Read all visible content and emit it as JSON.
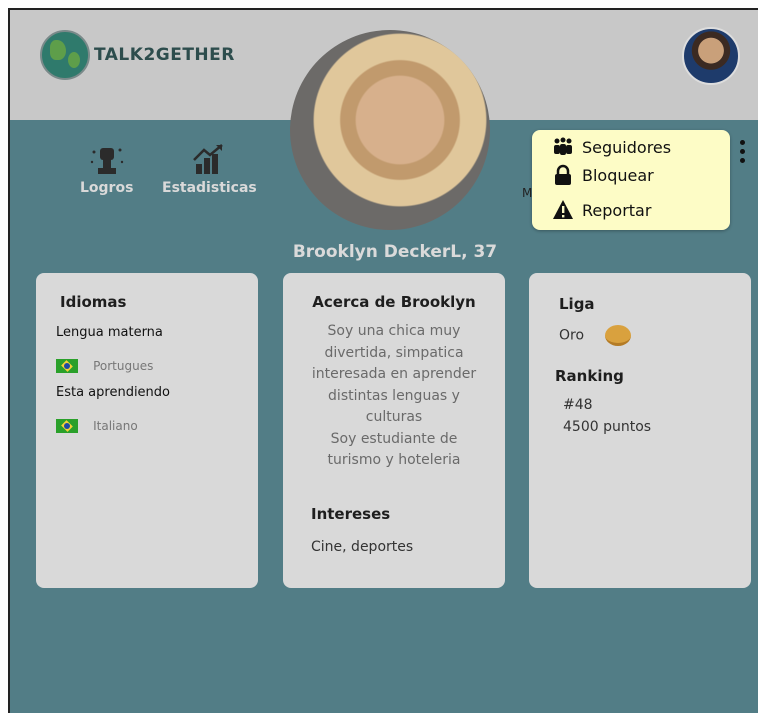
{
  "app": {
    "logo_text": "TALK2GETHER"
  },
  "nav": {
    "logros": "Logros",
    "estadisticas": "Estadisticas"
  },
  "profile": {
    "name": "Brooklyn DeckerL, 37"
  },
  "menu": {
    "items": [
      {
        "label": "Seguidores",
        "icon": "followers-icon"
      },
      {
        "label": "Bloquear",
        "icon": "lock-icon"
      },
      {
        "label": "Reportar",
        "icon": "warning-icon"
      }
    ],
    "peek_text": "M"
  },
  "idiomas": {
    "title": "Idiomas",
    "native_label": "Lengua materna",
    "native_language": "Portugues",
    "learning_label": "Esta aprendiendo",
    "learning_language": "Italiano"
  },
  "about": {
    "title": "Acerca de Brooklyn",
    "lines": [
      "Soy una chica muy",
      "divertida, simpatica",
      "interesada en aprender",
      "distintas lenguas y",
      "culturas",
      "Soy estudiante de",
      "turismo y hoteleria"
    ],
    "interests_title": "Intereses",
    "interests": "Cine, deportes"
  },
  "league": {
    "title": "Liga",
    "tier": "Oro",
    "ranking_title": "Ranking",
    "rank": "#48",
    "points": "4500 puntos"
  },
  "colors": {
    "teal": "#527d86",
    "card": "#d9d9d9",
    "popup": "#fdfcc6",
    "topbar": "#c8c8c8"
  }
}
